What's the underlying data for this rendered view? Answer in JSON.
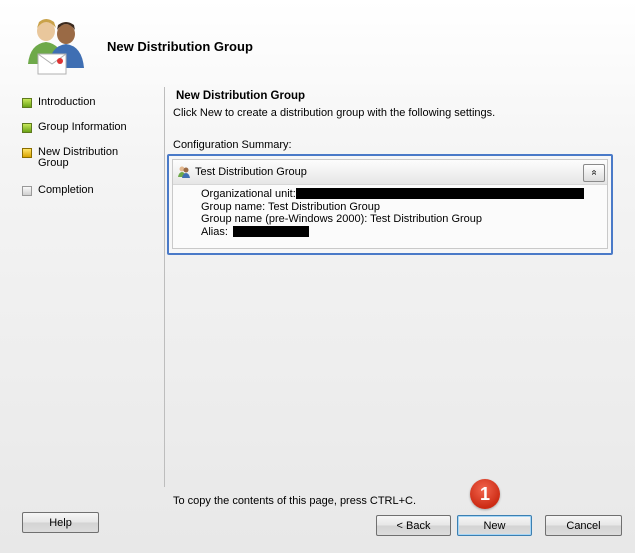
{
  "wizard": {
    "title": "New Distribution Group"
  },
  "steps": [
    {
      "label": "Introduction",
      "state": "done"
    },
    {
      "label": "Group Information",
      "state": "done"
    },
    {
      "label": "New Distribution Group",
      "state": "active"
    },
    {
      "label": "Completion",
      "state": "pending"
    }
  ],
  "page": {
    "title": "New Distribution Group",
    "description": "Click New to create a distribution group with the following settings.",
    "summary_label": "Configuration Summary:"
  },
  "summary": {
    "header": "Test Distribution Group",
    "collapse_glyph": "»",
    "rows": {
      "org_unit_label": "Organizational unit:",
      "group_name": "Group name: Test Distribution Group",
      "group_name_pre2000": "Group name (pre-Windows 2000): Test Distribution Group",
      "alias_label": "Alias:"
    }
  },
  "footer": {
    "note": "To copy the contents of this page, press CTRL+C."
  },
  "buttons": {
    "help": "Help",
    "back": "< Back",
    "new": "New",
    "cancel": "Cancel"
  },
  "annotation": {
    "number": "1",
    "color": "#e0402a"
  }
}
